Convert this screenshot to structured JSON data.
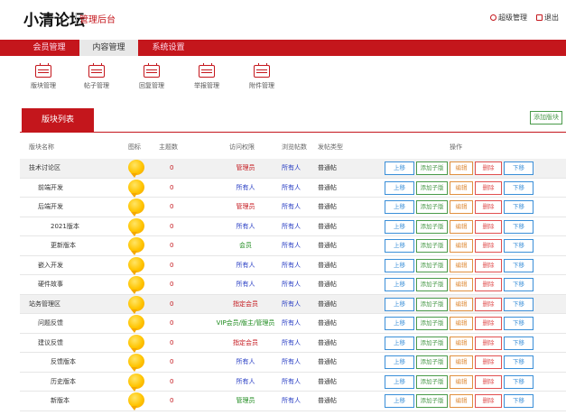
{
  "app": {
    "logo": "小清论坛",
    "subtitle": "管理后台"
  },
  "top_right": {
    "user": "超级管理",
    "logout": "退出"
  },
  "nav": {
    "tabs": [
      "会员管理",
      "内容管理",
      "系统设置"
    ],
    "active": 1
  },
  "subnav": [
    "版块管理",
    "帖子管理",
    "回复管理",
    "举报管理",
    "附件管理"
  ],
  "panel": {
    "tab": "版块列表",
    "add_button": "添加版块"
  },
  "table": {
    "headers": [
      "版块名称",
      "图标",
      "主题数",
      "访问权限",
      "浏览帖数",
      "发帖类型",
      "操作"
    ],
    "ops": {
      "up": "上移",
      "addsub": "添加子版",
      "edit": "编辑",
      "del": "删除",
      "down": "下移"
    },
    "rows": [
      {
        "name": "技术讨论区",
        "indent": 0,
        "topics": "0",
        "perm": "管理员",
        "perm_color": "red",
        "view": "所有人",
        "type": "普通帖",
        "hl": true
      },
      {
        "name": "前端开发",
        "indent": 1,
        "topics": "0",
        "perm": "所有人",
        "perm_color": "blue",
        "view": "所有人",
        "type": "普通帖",
        "hl": false
      },
      {
        "name": "后端开发",
        "indent": 1,
        "topics": "0",
        "perm": "管理员",
        "perm_color": "red",
        "view": "所有人",
        "type": "普通帖",
        "hl": false
      },
      {
        "name": "2021版本",
        "indent": 2,
        "topics": "0",
        "perm": "所有人",
        "perm_color": "blue",
        "view": "所有人",
        "type": "普通帖",
        "hl": false
      },
      {
        "name": "更新版本",
        "indent": 2,
        "topics": "0",
        "perm": "会员",
        "perm_color": "green",
        "view": "所有人",
        "type": "普通帖",
        "hl": false
      },
      {
        "name": "嵌入开发",
        "indent": 1,
        "topics": "0",
        "perm": "所有人",
        "perm_color": "blue",
        "view": "所有人",
        "type": "普通帖",
        "hl": false
      },
      {
        "name": "硬件故事",
        "indent": 1,
        "topics": "0",
        "perm": "所有人",
        "perm_color": "blue",
        "view": "所有人",
        "type": "普通帖",
        "hl": false
      },
      {
        "name": "站务管理区",
        "indent": 0,
        "topics": "0",
        "perm": "指定会员",
        "perm_color": "red",
        "view": "所有人",
        "type": "普通帖",
        "hl": true
      },
      {
        "name": "问题反馈",
        "indent": 1,
        "topics": "0",
        "perm": "VIP会员/版主/管理员",
        "perm_color": "green",
        "view": "所有人",
        "type": "普通帖",
        "hl": false
      },
      {
        "name": "建议反馈",
        "indent": 1,
        "topics": "0",
        "perm": "指定会员",
        "perm_color": "red",
        "view": "所有人",
        "type": "普通帖",
        "hl": false
      },
      {
        "name": "反馈版本",
        "indent": 2,
        "topics": "0",
        "perm": "所有人",
        "perm_color": "blue",
        "view": "所有人",
        "type": "普通帖",
        "hl": false
      },
      {
        "name": "历史版本",
        "indent": 2,
        "topics": "0",
        "perm": "所有人",
        "perm_color": "blue",
        "view": "所有人",
        "type": "普通帖",
        "hl": false
      },
      {
        "name": "新版本",
        "indent": 2,
        "topics": "0",
        "perm": "管理员",
        "perm_color": "green",
        "view": "所有人",
        "type": "普通帖",
        "hl": false
      }
    ]
  },
  "colors": {
    "accent": "#c4161c",
    "blue": "#3a8fd8",
    "green": "#4a9a4a",
    "orange": "#e09040"
  }
}
